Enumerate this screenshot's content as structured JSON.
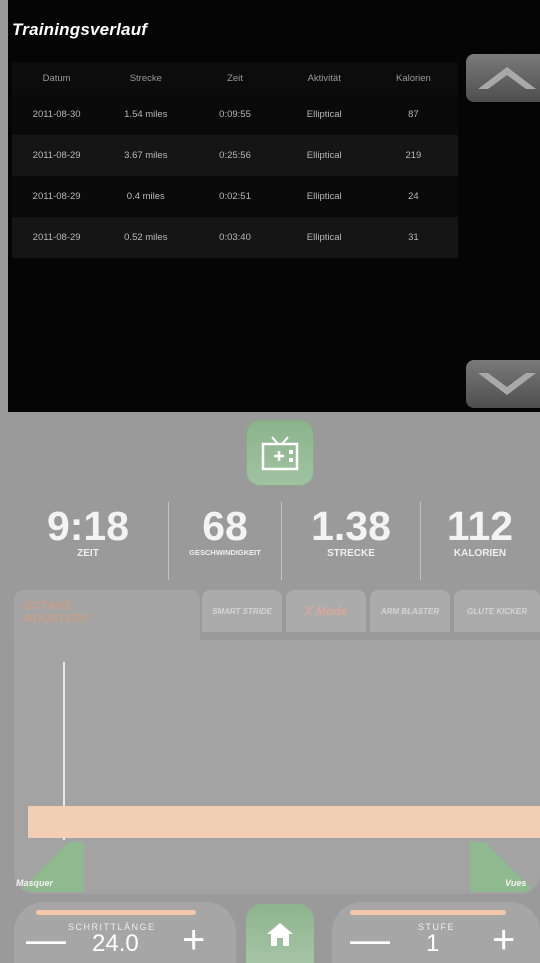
{
  "history": {
    "title": "Trainingsverlauf",
    "columns": [
      "Datum",
      "Strecke",
      "Zeit",
      "Aktivität",
      "Kalorien"
    ],
    "rows": [
      [
        "2011-08-30",
        "1.54 miles",
        "0:09:55",
        "Elliptical",
        "87"
      ],
      [
        "2011-08-29",
        "3.67 miles",
        "0:25:56",
        "Elliptical",
        "219"
      ],
      [
        "2011-08-29",
        "0.4 miles",
        "0:02:51",
        "Elliptical",
        "24"
      ],
      [
        "2011-08-29",
        "0.52 miles",
        "0:03:40",
        "Elliptical",
        "31"
      ]
    ],
    "scroll_up_icon": "chevron-up-icon",
    "scroll_down_icon": "chevron-down-icon"
  },
  "console": {
    "tv_icon": "tv-add-icon",
    "stats": [
      {
        "value": "9:18",
        "label": "ZEIT"
      },
      {
        "value": "68",
        "label": "GESCHWINDIGKEIT"
      },
      {
        "value": "1.38",
        "label": "STRECKE"
      },
      {
        "value": "112",
        "label": "KALORIEN"
      }
    ],
    "boosters": {
      "title_line1": "OCTANE",
      "title_line2": "BOOSTERS",
      "tabs": [
        "SMART STRIDE",
        "X Mode",
        "ARM BLASTER",
        "GLUTE KICKER"
      ]
    },
    "hide_label": "Masquer",
    "views_label": "Vues",
    "stride": {
      "label": "SCHRITTLÄNGE",
      "value": "24.0",
      "minus": "—",
      "plus": "+"
    },
    "level": {
      "label": "STUFE",
      "value": "1",
      "minus": "—",
      "plus": "+"
    },
    "home_icon": "home-icon",
    "colors": {
      "accent_green": "#8db48d",
      "bar_peach": "#f2cfb4",
      "panel_dark": "#050505"
    }
  }
}
